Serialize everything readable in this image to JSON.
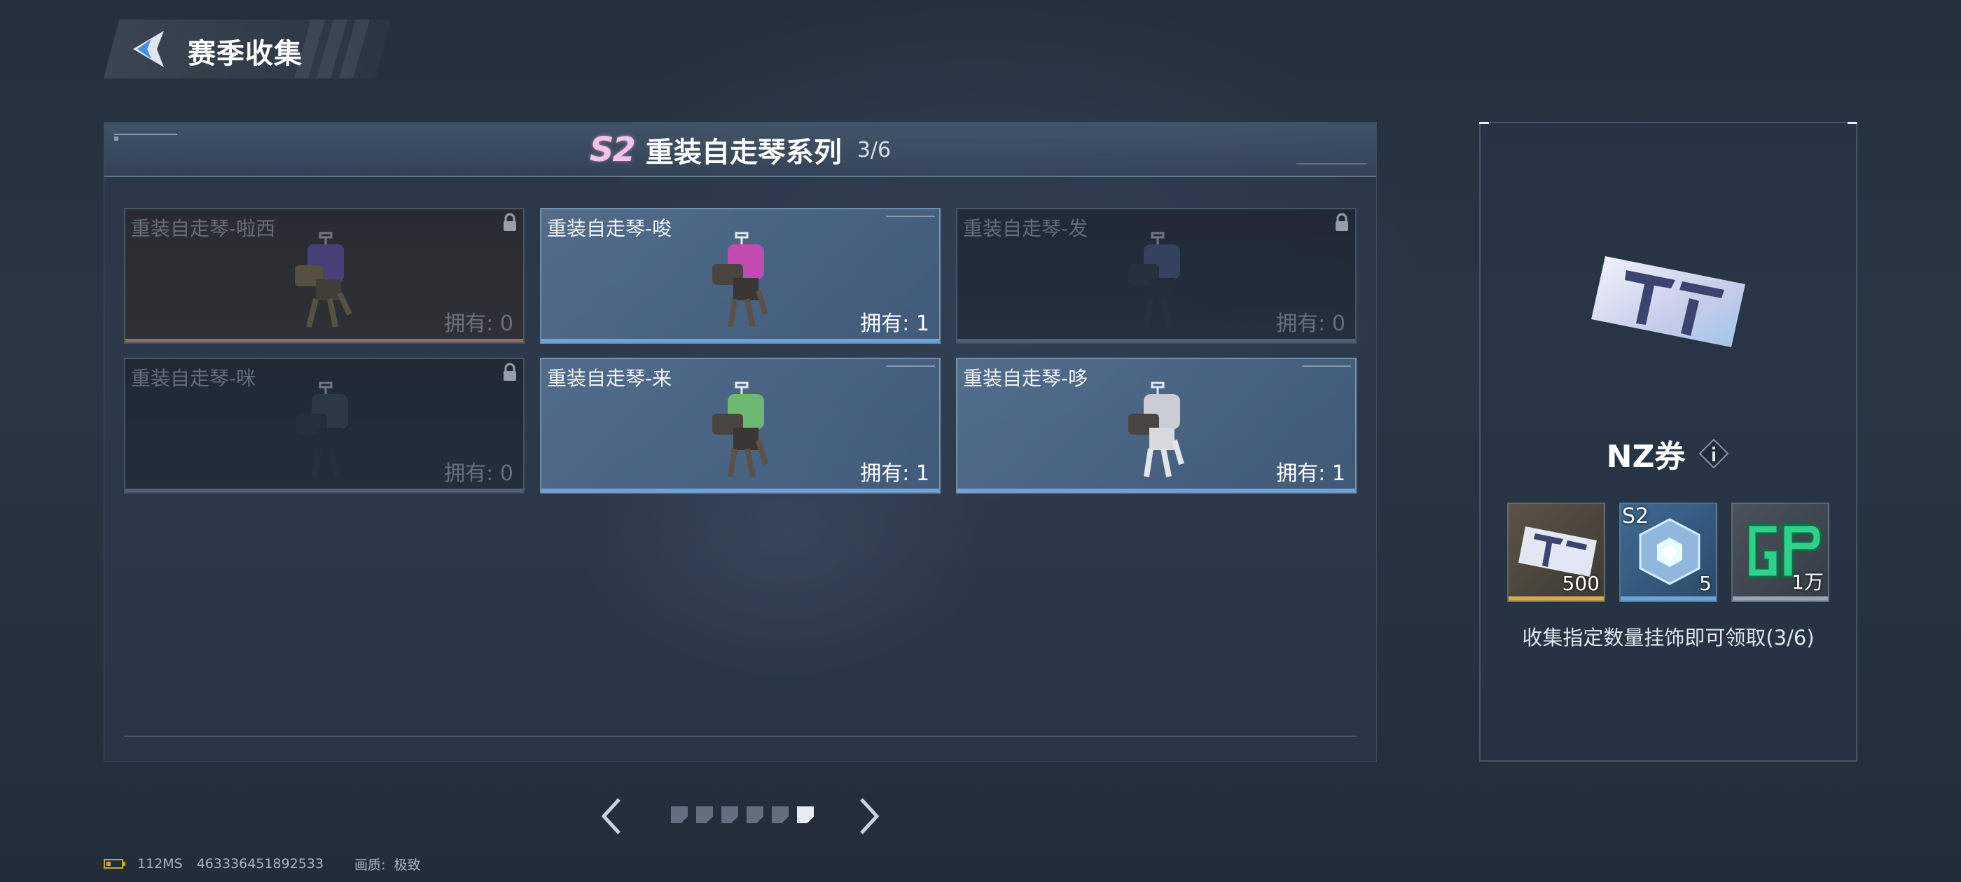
{
  "header": {
    "title": "赛季收集"
  },
  "series": {
    "season_badge": "S2",
    "name": "重装自走琴系列",
    "progress": "3/6"
  },
  "items": [
    {
      "name": "重装自走琴-啦西",
      "count": "拥有: 0",
      "owned": false,
      "accent": "#6a58c8"
    },
    {
      "name": "重装自走琴-唆",
      "count": "拥有: 1",
      "owned": true,
      "accent": "#c24bb0"
    },
    {
      "name": "重装自走琴-发",
      "count": "拥有: 0",
      "owned": false,
      "accent": "#4a5d8e"
    },
    {
      "name": "重装自走琴-咪",
      "count": "拥有: 0",
      "owned": false,
      "accent": "#3c4a5a"
    },
    {
      "name": "重装自走琴-来",
      "count": "拥有: 1",
      "owned": true,
      "accent": "#6fb874"
    },
    {
      "name": "重装自走琴-哆",
      "count": "拥有: 1",
      "owned": true,
      "accent": "#c9ccd3"
    }
  ],
  "pagination": {
    "total_pages": 6,
    "active_page": 6
  },
  "reward": {
    "name": "NZ券",
    "items": [
      {
        "qty": "500",
        "season": "",
        "icon": "nz-ticket-icon",
        "bar_color": "#d8a84a"
      },
      {
        "qty": "5",
        "season": "S2",
        "icon": "crystal-crate-icon",
        "bar_color": "#6ea3d8"
      },
      {
        "qty": "1万",
        "season": "",
        "icon": "gp-coin-icon",
        "bar_color": "#9aa3ae"
      }
    ],
    "collect_text": "收集指定数量挂饰即可领取(3/6)"
  },
  "footer": {
    "ping": "112MS",
    "player_id": "463336451892533",
    "quality_label": "画质:",
    "quality_value": "极致"
  },
  "colors": {
    "owned_bar": "#6ea3d8",
    "season_badge": "#f2c4e6"
  }
}
